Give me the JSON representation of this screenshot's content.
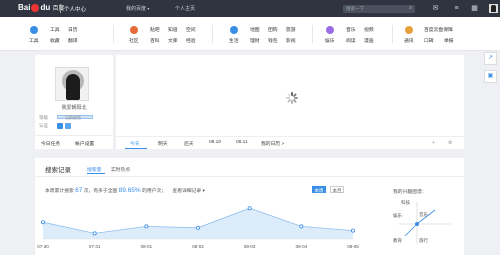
{
  "header": {
    "logo_text": "Bai",
    "logo_text2": "du",
    "logo_cn": "百度",
    "section": "个人中心",
    "nav": [
      {
        "label": "我的百度",
        "caret": "▾"
      },
      {
        "label": "个人主页"
      }
    ],
    "search_placeholder": "搜索一下",
    "icons": [
      "mail-icon",
      "menu-icon",
      "grid-icon"
    ]
  },
  "services": [
    {
      "label": "工具",
      "sub": [
        "工具",
        "收藏",
        "日历",
        "翻译"
      ],
      "color": "#3a8ee6"
    },
    {
      "label": "社区",
      "sub": [
        "贴吧",
        "知道",
        "空间",
        "百科",
        "文库",
        "经验"
      ],
      "color": "#e66a3a"
    },
    {
      "label": "生活",
      "sub": [
        "地图",
        "团购",
        "旅游",
        "理财",
        "钱包",
        "影视"
      ],
      "color": "#3a8ee6"
    },
    {
      "label": "娱乐",
      "sub": [
        "音乐",
        "视频",
        "游戏",
        "阅读",
        "漫画",
        "图片"
      ],
      "color": "#9a6ae6"
    },
    {
      "label": "通讯",
      "sub": [
        "百度云盘保障",
        "口碑",
        "举报"
      ],
      "color": "#e6a23a"
    }
  ],
  "sidefloat": [
    "share-icon",
    "qr-icon"
  ],
  "profile": {
    "name": "我爱朝阳北",
    "rows": [
      {
        "label": "等级",
        "value": "当前经验"
      },
      {
        "label": "认证"
      }
    ],
    "footer": [
      "今日任务",
      "帐户设置"
    ]
  },
  "feed": {
    "dates": [
      "今天",
      "明天",
      "后天",
      "08.10",
      "08.11",
      "我的日历 >"
    ],
    "tools": [
      "+",
      "⚙"
    ]
  },
  "records": {
    "title": "搜索记录",
    "tabs": [
      "搜索量",
      "实时热点"
    ],
    "stats_prefix": "本周累计搜索",
    "stats_count": "67",
    "stats_mid": "次，有多于全国",
    "stats_pct": "89.65%",
    "stats_suffix": "的用户次；",
    "stats_link": "查看详细记录 ▾",
    "toggles": [
      "本周",
      "本月"
    ],
    "side_title": "我的兴趣图谱："
  },
  "chart_data": {
    "type": "area",
    "categories": [
      "07-30",
      "07-31",
      "08-01",
      "08-02",
      "08-03",
      "08-04",
      "08-05"
    ],
    "values": [
      12,
      4,
      9,
      8,
      22,
      9,
      6
    ],
    "ylim": [
      0,
      30
    ],
    "color": "#3a8ee6"
  },
  "interest_labels": [
    "科技",
    "娱乐",
    "教育",
    "旅行",
    "音乐"
  ]
}
